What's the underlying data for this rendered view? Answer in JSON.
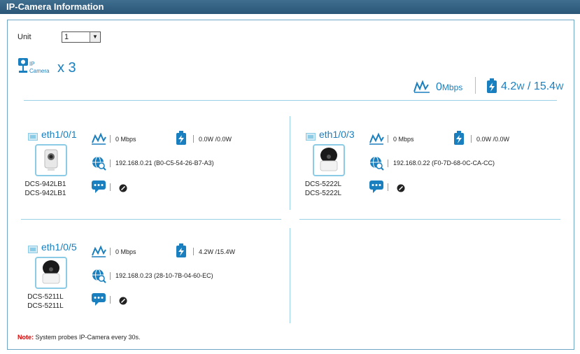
{
  "window": {
    "title": "IP-Camera Information"
  },
  "unit": {
    "label": "Unit",
    "selected": "1"
  },
  "summary": {
    "icon_name": "ip-camera-icon",
    "icon_text": "IP Camera",
    "count_text": "x 3",
    "throughput_value": "0",
    "throughput_unit": "Mbps",
    "power_value": "4.2",
    "power_unit": "W",
    "power_sep": " / ",
    "power_budget": "15.4",
    "power_budget_unit": "W"
  },
  "ports": [
    {
      "port": "eth1/0/1",
      "model_line1": "DCS-942LB1",
      "model_line2": "DCS-942LB1",
      "throughput": "0 Mbps",
      "power": "0.0W /0.0W",
      "ip_mac": "192.168.0.21 (B0-C5-54-26-B7-A3)",
      "camera_style": "cube"
    },
    {
      "port": "eth1/0/3",
      "model_line1": "DCS-5222L",
      "model_line2": "DCS-5222L",
      "throughput": "0 Mbps",
      "power": "0.0W /0.0W",
      "ip_mac": "192.168.0.22 (F0-7D-68-0C-CA-CC)",
      "camera_style": "dome"
    },
    {
      "port": "eth1/0/5",
      "model_line1": "DCS-5211L",
      "model_line2": "DCS-5211L",
      "throughput": "0 Mbps",
      "power": "4.2W /15.4W",
      "ip_mac": "192.168.0.23 (28-10-7B-04-60-EC)",
      "camera_style": "dome"
    }
  ],
  "note": {
    "label": "Note:",
    "text": " System probes IP-Camera every 30s."
  },
  "colors": {
    "accent": "#1a7fbf",
    "titlebar": "#2b5677",
    "divider": "#9cd0e6",
    "note_label": "#e00000"
  }
}
